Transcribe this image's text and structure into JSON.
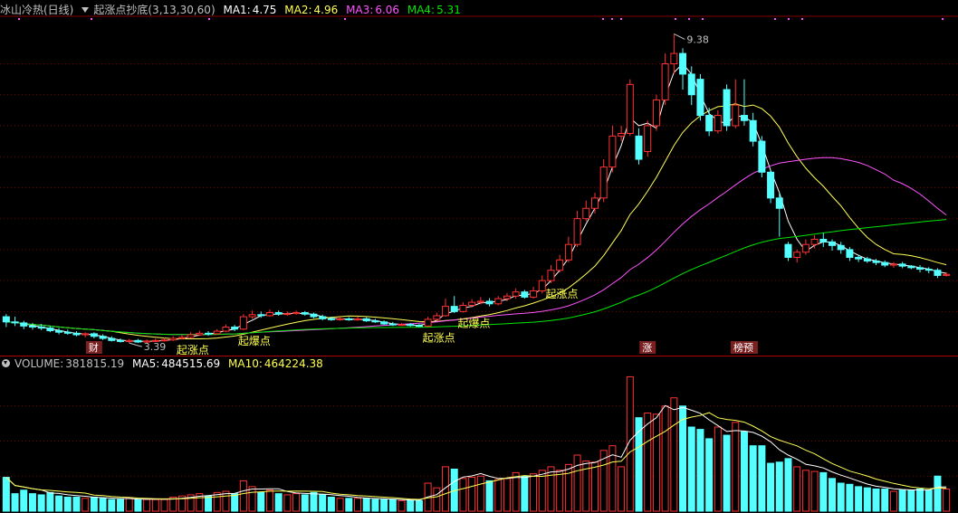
{
  "main_header": {
    "indicator1": "冰山冷热(日线)",
    "indicator2": "起涨点抄底(3,13,30,60)",
    "ma1_label": "MA1:",
    "ma1_value": "4.75",
    "ma2_label": "MA2:",
    "ma2_value": "4.96",
    "ma3_label": "MA3:",
    "ma3_value": "6.06",
    "ma4_label": "MA4:",
    "ma4_value": "5.31"
  },
  "volume_header": {
    "label": "VOLUME:",
    "value": "381815.19",
    "ma5_label": "MA5:",
    "ma5_value": "484515.69",
    "ma10_label": "MA10:",
    "ma10_value": "464224.38"
  },
  "colors": {
    "up": "#ff3232",
    "down": "#54ffff",
    "ma1": "#ffffff",
    "ma2": "#ffff54",
    "ma3": "#ff54ff",
    "ma4": "#00e600",
    "grid": "#7f0000",
    "text": "#c0c0c0"
  },
  "chart_data": {
    "type": "candlestick",
    "price_markers": {
      "high": "9.38",
      "low": "3.39"
    },
    "signal_labels": [
      {
        "text": "起涨点",
        "index": 20
      },
      {
        "text": "起爆点",
        "index": 27
      },
      {
        "text": "起涨点",
        "index": 48
      },
      {
        "text": "起爆点",
        "index": 52
      },
      {
        "text": "起涨点",
        "index": 62
      }
    ],
    "event_tags": [
      {
        "text": "财",
        "index": 10
      },
      {
        "text": "涨",
        "index": 73
      },
      {
        "text": "榜预",
        "index": 84
      }
    ],
    "candles": [
      [
        3.9,
        3.8,
        3.95,
        3.7,
        290000
      ],
      [
        3.8,
        3.78,
        3.9,
        3.72,
        150000
      ],
      [
        3.78,
        3.72,
        3.82,
        3.66,
        180000
      ],
      [
        3.72,
        3.7,
        3.78,
        3.65,
        150000
      ],
      [
        3.7,
        3.68,
        3.76,
        3.64,
        140000
      ],
      [
        3.68,
        3.63,
        3.72,
        3.6,
        160000
      ],
      [
        3.63,
        3.6,
        3.68,
        3.56,
        130000
      ],
      [
        3.6,
        3.58,
        3.65,
        3.55,
        120000
      ],
      [
        3.58,
        3.55,
        3.62,
        3.52,
        120000
      ],
      [
        3.55,
        3.57,
        3.6,
        3.5,
        110000
      ],
      [
        3.57,
        3.52,
        3.6,
        3.48,
        120000
      ],
      [
        3.52,
        3.48,
        3.56,
        3.45,
        110000
      ],
      [
        3.48,
        3.44,
        3.52,
        3.42,
        100000
      ],
      [
        3.44,
        3.42,
        3.48,
        3.4,
        100000
      ],
      [
        3.42,
        3.44,
        3.47,
        3.39,
        110000
      ],
      [
        3.44,
        3.41,
        3.47,
        3.39,
        100000
      ],
      [
        3.41,
        3.43,
        3.46,
        3.39,
        100000
      ],
      [
        3.43,
        3.44,
        3.48,
        3.41,
        100000
      ],
      [
        3.44,
        3.45,
        3.49,
        3.42,
        100000
      ],
      [
        3.45,
        3.48,
        3.52,
        3.43,
        120000
      ],
      [
        3.48,
        3.5,
        3.55,
        3.46,
        130000
      ],
      [
        3.5,
        3.55,
        3.6,
        3.48,
        140000
      ],
      [
        3.55,
        3.58,
        3.63,
        3.53,
        150000
      ],
      [
        3.58,
        3.57,
        3.62,
        3.53,
        130000
      ],
      [
        3.57,
        3.62,
        3.66,
        3.55,
        160000
      ],
      [
        3.62,
        3.7,
        3.75,
        3.6,
        170000
      ],
      [
        3.7,
        3.66,
        3.74,
        3.62,
        150000
      ],
      [
        3.66,
        3.9,
        3.95,
        3.64,
        260000
      ],
      [
        3.9,
        3.94,
        4.02,
        3.86,
        210000
      ],
      [
        3.94,
        3.92,
        4.0,
        3.88,
        160000
      ],
      [
        3.92,
        3.98,
        4.04,
        3.9,
        180000
      ],
      [
        3.98,
        3.95,
        4.02,
        3.92,
        150000
      ],
      [
        3.95,
        3.96,
        4.0,
        3.92,
        140000
      ],
      [
        3.96,
        3.98,
        4.02,
        3.94,
        150000
      ],
      [
        3.98,
        3.95,
        4.01,
        3.92,
        140000
      ],
      [
        3.95,
        3.9,
        3.98,
        3.87,
        160000
      ],
      [
        3.9,
        3.86,
        3.94,
        3.83,
        140000
      ],
      [
        3.86,
        3.85,
        3.9,
        3.82,
        120000
      ],
      [
        3.85,
        3.86,
        3.9,
        3.82,
        110000
      ],
      [
        3.86,
        3.84,
        3.89,
        3.82,
        110000
      ],
      [
        3.84,
        3.86,
        3.9,
        3.82,
        110000
      ],
      [
        3.86,
        3.82,
        3.89,
        3.8,
        110000
      ],
      [
        3.82,
        3.8,
        3.86,
        3.78,
        100000
      ],
      [
        3.8,
        3.76,
        3.83,
        3.74,
        100000
      ],
      [
        3.76,
        3.74,
        3.8,
        3.72,
        100000
      ],
      [
        3.74,
        3.75,
        3.78,
        3.72,
        90000
      ],
      [
        3.75,
        3.73,
        3.78,
        3.71,
        90000
      ],
      [
        3.73,
        3.72,
        3.76,
        3.7,
        90000
      ],
      [
        3.72,
        3.85,
        3.9,
        3.7,
        240000
      ],
      [
        3.85,
        3.92,
        3.98,
        3.82,
        200000
      ],
      [
        3.92,
        4.1,
        4.25,
        3.9,
        380000
      ],
      [
        4.1,
        4.0,
        4.3,
        3.97,
        360000
      ],
      [
        4.0,
        4.12,
        4.18,
        3.98,
        280000
      ],
      [
        4.12,
        4.18,
        4.24,
        4.08,
        290000
      ],
      [
        4.18,
        4.2,
        4.28,
        4.14,
        300000
      ],
      [
        4.2,
        4.15,
        4.26,
        4.1,
        260000
      ],
      [
        4.15,
        4.25,
        4.3,
        4.12,
        270000
      ],
      [
        4.25,
        4.3,
        4.36,
        4.2,
        280000
      ],
      [
        4.3,
        4.38,
        4.45,
        4.25,
        330000
      ],
      [
        4.38,
        4.28,
        4.42,
        4.25,
        300000
      ],
      [
        4.28,
        4.4,
        4.48,
        4.25,
        320000
      ],
      [
        4.4,
        4.6,
        4.7,
        4.35,
        350000
      ],
      [
        4.6,
        4.8,
        4.9,
        4.55,
        380000
      ],
      [
        4.8,
        5.0,
        5.1,
        4.76,
        350000
      ],
      [
        5.0,
        5.3,
        5.45,
        4.95,
        400000
      ],
      [
        5.3,
        5.8,
        5.95,
        5.25,
        480000
      ],
      [
        5.8,
        6.0,
        6.15,
        5.75,
        430000
      ],
      [
        6.0,
        6.2,
        6.3,
        5.9,
        420000
      ],
      [
        6.2,
        6.8,
        6.95,
        6.12,
        520000
      ],
      [
        6.8,
        7.4,
        7.6,
        6.7,
        560000
      ],
      [
        7.4,
        7.45,
        7.6,
        7.3,
        380000
      ],
      [
        7.45,
        8.4,
        8.5,
        7.4,
        1150000
      ],
      [
        7.4,
        6.95,
        7.55,
        6.85,
        800000
      ],
      [
        7.1,
        7.6,
        7.7,
        7.0,
        840000
      ],
      [
        7.6,
        8.1,
        8.2,
        7.5,
        830000
      ],
      [
        8.1,
        8.8,
        9.0,
        8.0,
        900000
      ],
      [
        8.8,
        9.0,
        9.38,
        8.6,
        970000
      ],
      [
        9.0,
        8.6,
        9.1,
        8.3,
        900000
      ],
      [
        8.6,
        8.2,
        8.75,
        8.0,
        720000
      ],
      [
        8.5,
        7.8,
        8.6,
        7.7,
        700000
      ],
      [
        7.8,
        7.5,
        7.95,
        7.4,
        620000
      ],
      [
        7.5,
        7.8,
        7.9,
        7.45,
        720000
      ],
      [
        8.3,
        7.6,
        8.4,
        7.5,
        650000
      ],
      [
        7.6,
        8.0,
        8.5,
        7.55,
        760000
      ],
      [
        7.8,
        7.7,
        8.5,
        7.6,
        680000
      ],
      [
        7.7,
        7.3,
        7.85,
        7.2,
        560000
      ],
      [
        7.3,
        6.7,
        7.4,
        6.6,
        560000
      ],
      [
        6.7,
        6.2,
        6.75,
        6.1,
        410000
      ],
      [
        6.2,
        6.0,
        6.3,
        5.45,
        420000
      ],
      [
        5.3,
        5.05,
        5.35,
        4.98,
        450000
      ],
      [
        5.05,
        5.15,
        5.2,
        4.95,
        380000
      ],
      [
        5.15,
        5.3,
        5.4,
        5.1,
        350000
      ],
      [
        5.3,
        5.4,
        5.48,
        5.22,
        340000
      ],
      [
        5.4,
        5.35,
        5.52,
        5.25,
        330000
      ],
      [
        5.35,
        5.28,
        5.4,
        5.18,
        280000
      ],
      [
        5.28,
        5.2,
        5.35,
        5.12,
        240000
      ],
      [
        5.2,
        5.05,
        5.25,
        4.98,
        230000
      ],
      [
        5.05,
        5.02,
        5.1,
        4.96,
        210000
      ],
      [
        5.02,
        4.98,
        5.06,
        4.94,
        200000
      ],
      [
        4.98,
        4.95,
        5.02,
        4.9,
        190000
      ],
      [
        4.95,
        4.9,
        4.99,
        4.86,
        190000
      ],
      [
        4.9,
        4.92,
        4.96,
        4.85,
        170000
      ],
      [
        4.92,
        4.88,
        4.96,
        4.84,
        180000
      ],
      [
        4.88,
        4.85,
        4.9,
        4.82,
        180000
      ],
      [
        4.85,
        4.82,
        4.9,
        4.76,
        190000
      ],
      [
        4.82,
        4.8,
        4.86,
        4.74,
        180000
      ],
      [
        4.8,
        4.7,
        4.84,
        4.65,
        300000
      ],
      [
        4.7,
        4.72,
        4.76,
        4.68,
        190000
      ]
    ]
  }
}
